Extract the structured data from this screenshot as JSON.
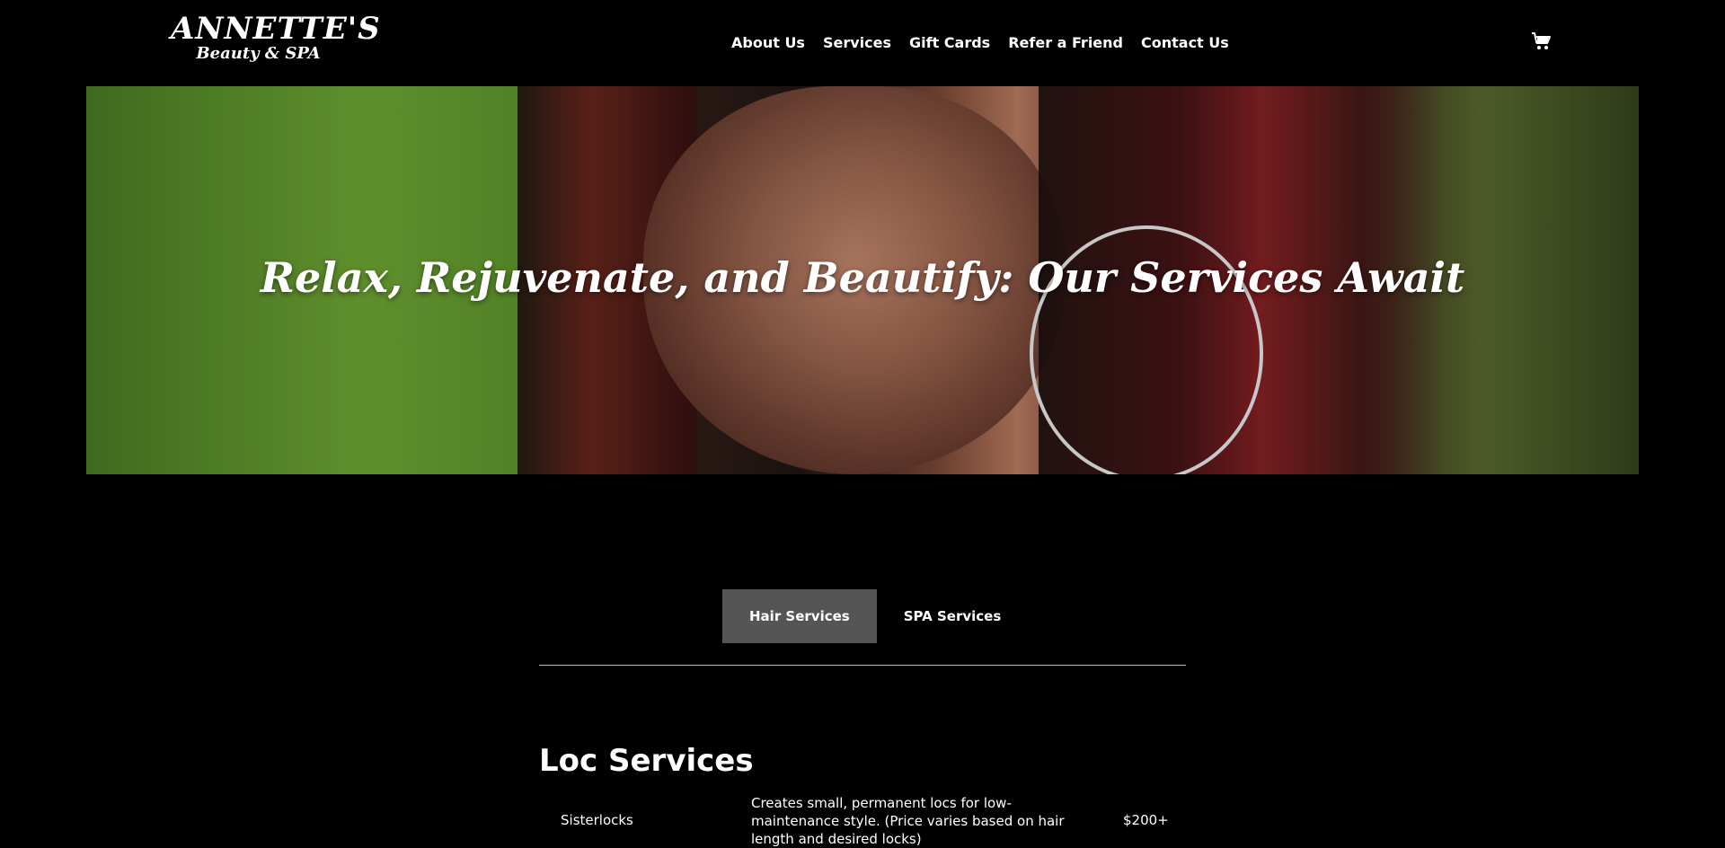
{
  "header": {
    "logo_main": "ANNETTE'S",
    "logo_sub": "Beauty & SPA",
    "nav": [
      "About Us",
      "Services",
      "Gift Cards",
      "Refer a Friend",
      "Contact Us"
    ],
    "cart_icon": "shopping-cart-icon"
  },
  "hero": {
    "title": "Relax, Rejuvenate, and Beautify: Our Services Await"
  },
  "tabs": [
    {
      "label": "Hair Services",
      "active": true
    },
    {
      "label": "SPA Services",
      "active": false
    }
  ],
  "section": {
    "title": "Loc Services",
    "rows": [
      {
        "name": "Sisterlocks",
        "description": "Creates small, permanent locs for low-maintenance style. (Price varies based on hair length and desired locks)",
        "price": "$200+"
      }
    ]
  },
  "colors": {
    "background": "#000000",
    "active_tab": "#555555",
    "divider": "#bdbdbd",
    "text": "#ffffff"
  }
}
